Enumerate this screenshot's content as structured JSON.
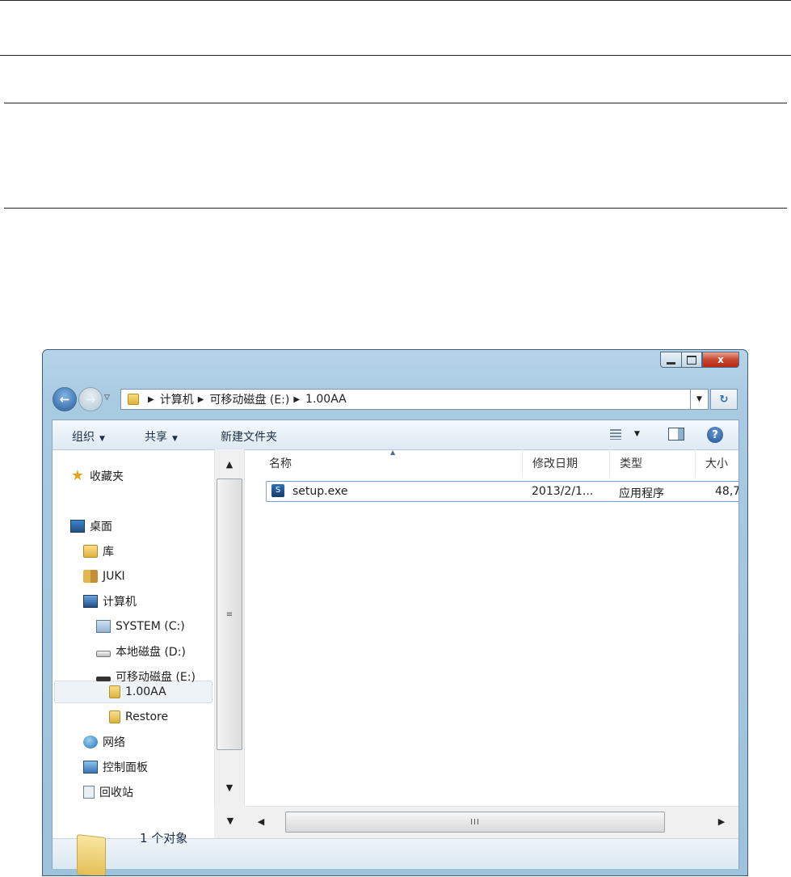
{
  "window": {
    "controls": {
      "minimize": "",
      "maximize": "",
      "close": "x"
    }
  },
  "address": {
    "crumbs": [
      "计算机",
      "可移动磁盘 (E:)",
      "1.00AA"
    ]
  },
  "toolbar": {
    "organize": "组织",
    "share": "共享",
    "new_folder": "新建文件夹",
    "help": "?"
  },
  "nav": {
    "items": [
      {
        "label": "收藏夹",
        "icon": "star-icon"
      },
      {
        "label": "桌面",
        "icon": "desktop-icon"
      },
      {
        "label": "库",
        "icon": "library-icon"
      },
      {
        "label": "JUKI",
        "icon": "user-folder-icon"
      },
      {
        "label": "计算机",
        "icon": "computer-icon"
      },
      {
        "label": "SYSTEM (C:)",
        "icon": "system-drive-icon"
      },
      {
        "label": "本地磁盘 (D:)",
        "icon": "hard-drive-icon"
      },
      {
        "label": "可移动磁盘 (E:)",
        "icon": "removable-drive-icon"
      },
      {
        "label": "1.00AA",
        "icon": "folder-icon",
        "selected": true
      },
      {
        "label": "Restore",
        "icon": "folder-icon"
      },
      {
        "label": "网络",
        "icon": "network-icon"
      },
      {
        "label": "控制面板",
        "icon": "control-panel-icon"
      },
      {
        "label": "回收站",
        "icon": "recycle-bin-icon"
      }
    ]
  },
  "list": {
    "columns": [
      "名称",
      "修改日期",
      "类型",
      "大小"
    ],
    "rows": [
      {
        "name": "setup.exe",
        "date": "2013/2/1...",
        "type": "应用程序",
        "size": "48,7",
        "icon": "exe-icon"
      }
    ]
  },
  "scrollbar": {
    "grip_v": "≡",
    "grip_h": "III"
  },
  "status": {
    "count": "1 个对象"
  }
}
